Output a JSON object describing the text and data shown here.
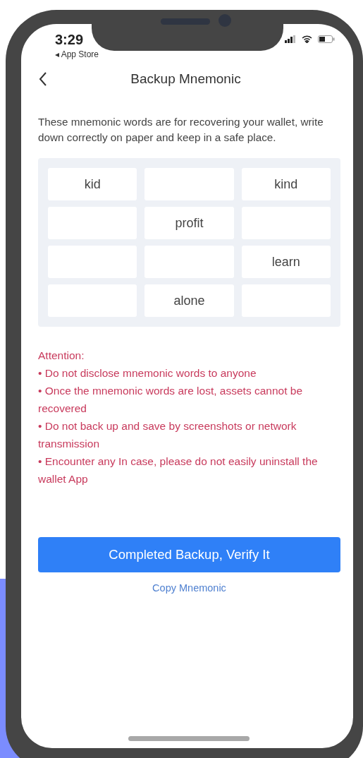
{
  "status_bar": {
    "time": "3:29",
    "back_app": "◂ App Store"
  },
  "header": {
    "title": "Backup Mnemonic"
  },
  "description": "These mnemonic words are for recovering your wallet, write down correctly on paper and keep in a safe place.",
  "cells": [
    {
      "word": "kid"
    },
    {},
    {
      "word": "kind"
    },
    {},
    {
      "word": "profit"
    },
    {},
    {},
    {},
    {
      "word": "learn"
    },
    {},
    {
      "word": "alone"
    },
    {}
  ],
  "attention": {
    "title": "Attention:",
    "items": [
      "• Do not disclose mnemonic words to anyone",
      "• Once the mnemonic words are lost, assets cannot be recovered",
      "• Do not back up and save by screenshots or network transmission",
      "• Encounter any In case, please do not easily uninstall the wallet App"
    ]
  },
  "primary_button": "Completed Backup, Verify It",
  "link": "Copy Mnemonic"
}
